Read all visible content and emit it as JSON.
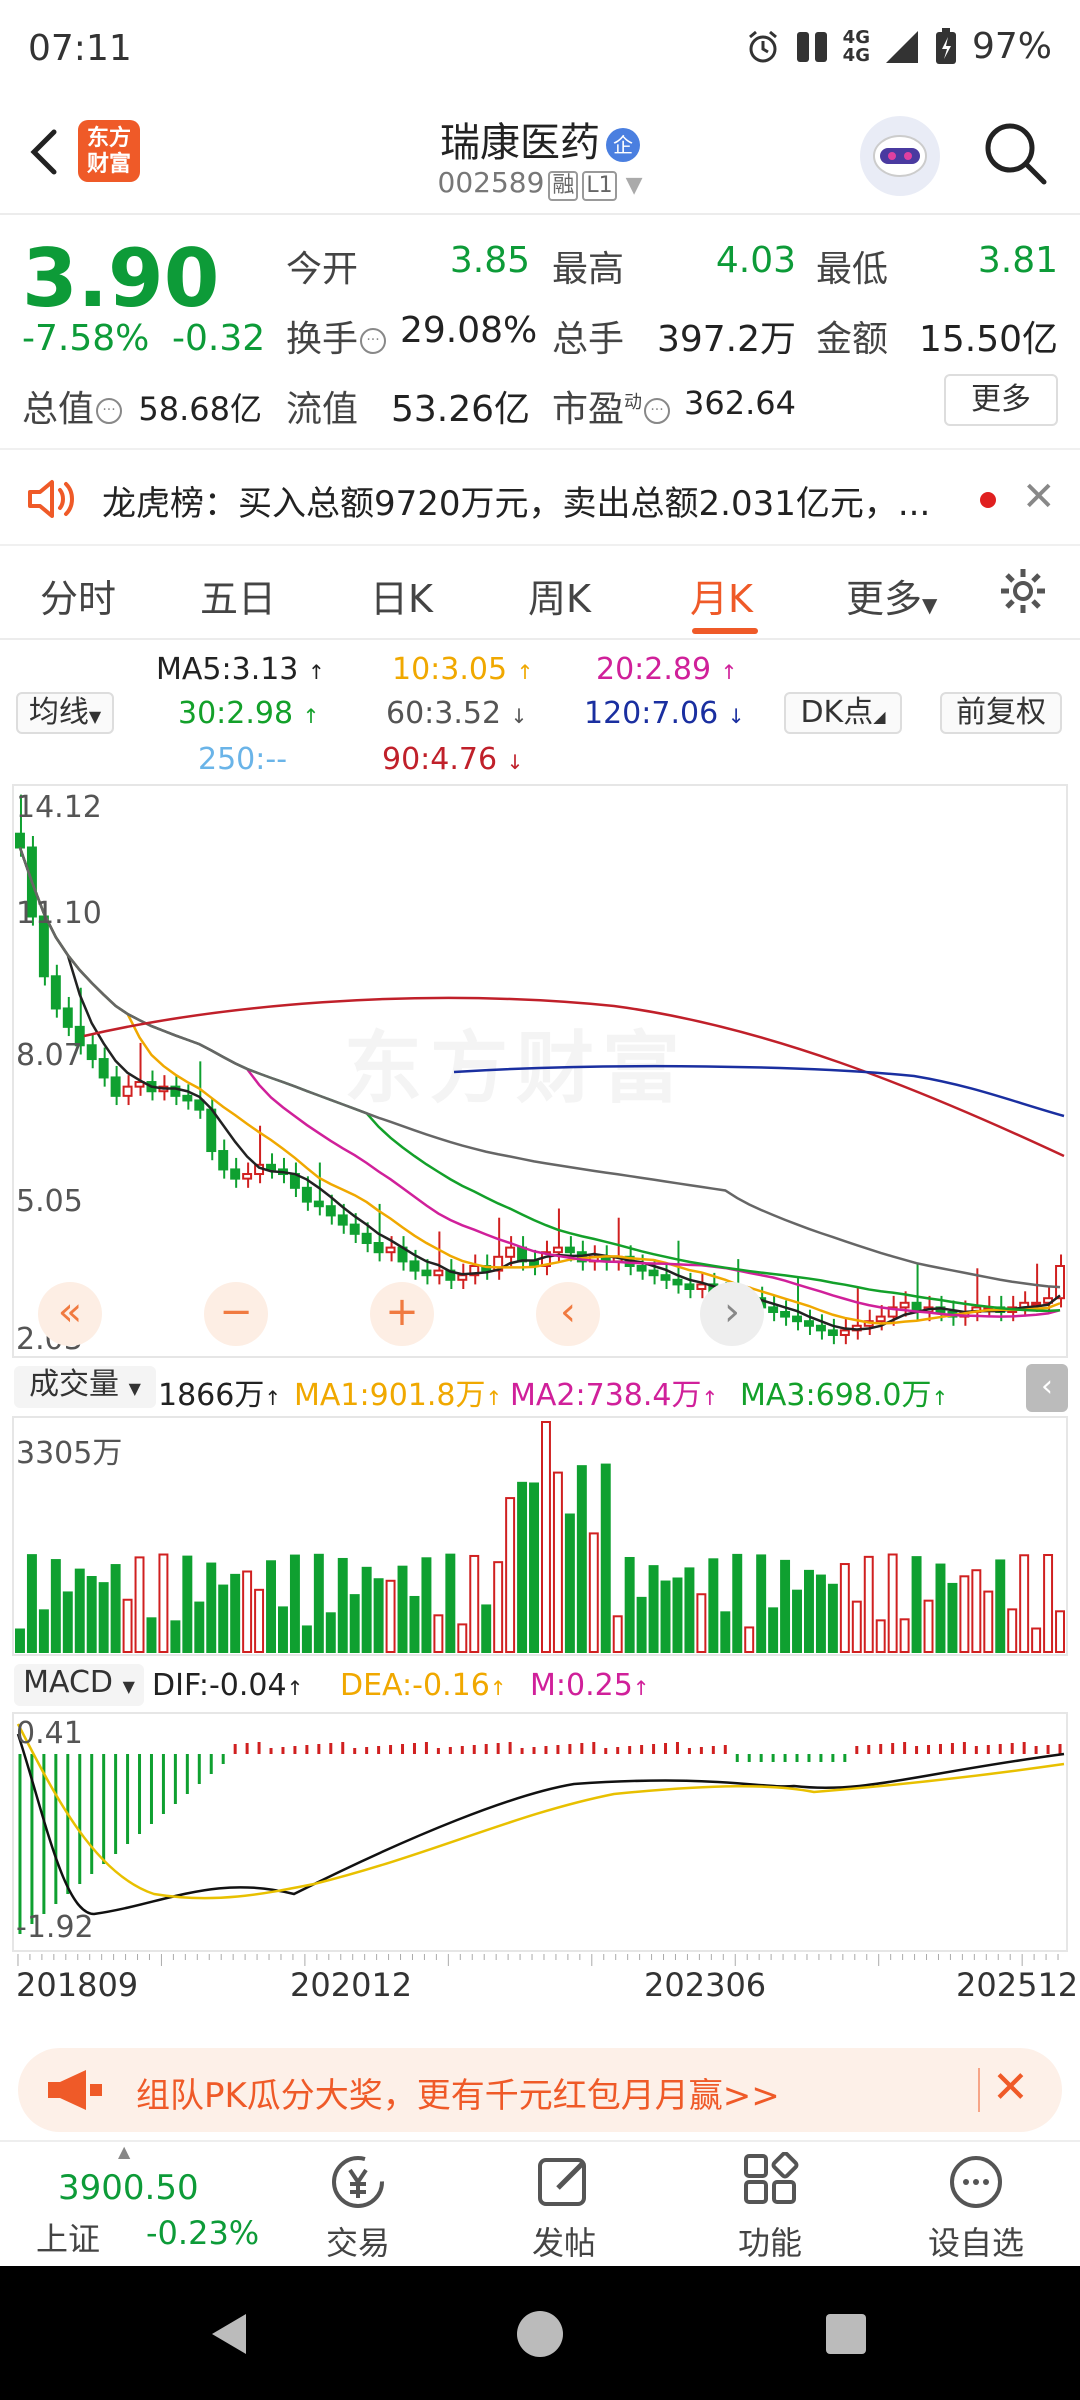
{
  "status": {
    "time": "07:11",
    "net_top": "4G",
    "net_bottom": "4G",
    "battery": "97%"
  },
  "header": {
    "title": "瑞康医药",
    "qi_badge": "企",
    "code": "002589",
    "rong": "融",
    "level": "L1",
    "logo_line1": "东方",
    "logo_line2": "财富"
  },
  "quote": {
    "price": "3.90",
    "pct": "-7.58%",
    "chg": "-0.32",
    "open_label": "今开",
    "open": "3.85",
    "high_label": "最高",
    "high": "4.03",
    "low_label": "最低",
    "low": "3.81",
    "turnover_label": "换手",
    "turnover": "29.08%",
    "volume_label": "总手",
    "volume": "397.2万",
    "amount_label": "金额",
    "amount": "15.50亿",
    "mcap_label": "总值",
    "mcap": "58.68亿",
    "float_label": "流值",
    "float": "53.26亿",
    "pe_label": "市盈",
    "pe_sup": "动",
    "pe": "362.64",
    "more": "更多"
  },
  "notice": {
    "text": "龙虎榜：买入总额9720万元，卖出总额2.031亿元，..."
  },
  "tabs": [
    "分时",
    "五日",
    "日K",
    "周K",
    "月K",
    "更多"
  ],
  "ma": {
    "selector": "均线",
    "ma5": "MA5:3.13",
    "ma10": "10:3.05",
    "ma20": "20:2.89",
    "ma30": "30:2.98",
    "ma60": "60:3.52",
    "ma120": "120:7.06",
    "ma250": "250:--",
    "ma90": "90:4.76",
    "dk": "DK点",
    "fuquan": "前复权",
    "colors": {
      "ma5": "#222222",
      "ma10": "#f0a800",
      "ma20": "#d0209a",
      "ma30": "#13a02a",
      "ma60": "#666666",
      "ma120": "#1a2fa0",
      "ma250": "#6ab4e8",
      "ma90": "#c0202a"
    }
  },
  "kline": {
    "y_labels": [
      "14.12",
      "11.10",
      "8.07",
      "5.05",
      "2.03"
    ],
    "watermark": "东方财富"
  },
  "volume": {
    "selector": "成交量",
    "value": "1866万",
    "ma1": "MA1:901.8万",
    "ma2": "MA2:738.4万",
    "ma3": "MA3:698.0万",
    "max_label": "3305万"
  },
  "macd": {
    "selector": "MACD",
    "dif": "DIF:-0.04",
    "dea": "DEA:-0.16",
    "m": "M:0.25",
    "top": "0.41",
    "bottom": "-1.92"
  },
  "dates": [
    "201809",
    "202012",
    "202306",
    "202512"
  ],
  "banner": {
    "text": "组队PK瓜分大奖，更有千元红包月月赢>>"
  },
  "bottom": {
    "index_value": "3900.50",
    "index_name": "上证",
    "index_change": "-0.23%",
    "trade": "交易",
    "post": "发帖",
    "func": "功能",
    "watch": "设自选"
  }
}
